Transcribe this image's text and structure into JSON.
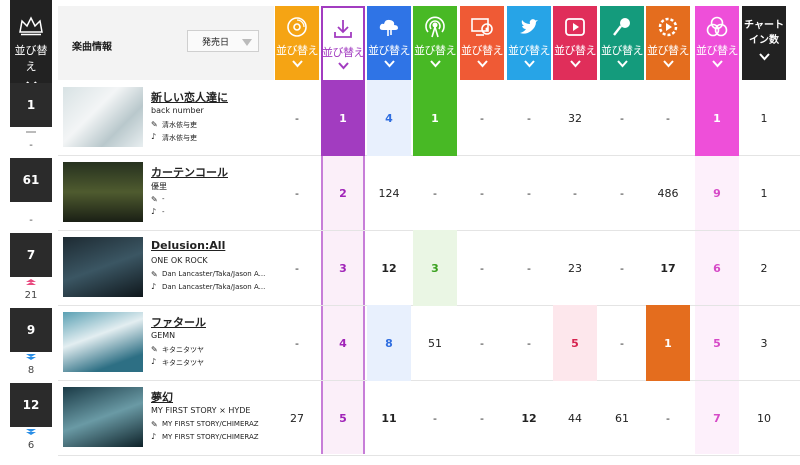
{
  "header": {
    "sort_label": "並び替え",
    "info_label": "楽曲情報",
    "release_select": "発売日",
    "chart_in_label_1": "チャート",
    "chart_in_label_2": "イン数"
  },
  "columns": [
    {
      "key": "cd",
      "color": "#f5a414",
      "icon": "cd-icon"
    },
    {
      "key": "download",
      "color": "#ffffff",
      "icon": "download-icon"
    },
    {
      "key": "streaming",
      "color": "#2f74e6",
      "icon": "cloud-music-icon"
    },
    {
      "key": "radio",
      "color": "#48b925",
      "icon": "broadcast-icon"
    },
    {
      "key": "karaoke_tv",
      "color": "#ef5a35",
      "icon": "tv-disc-icon"
    },
    {
      "key": "twitter",
      "color": "#27a4e7",
      "icon": "twitter-icon"
    },
    {
      "key": "youtube",
      "color": "#e02e5a",
      "icon": "play-icon"
    },
    {
      "key": "karaoke",
      "color": "#149b7c",
      "icon": "microphone-icon"
    },
    {
      "key": "gyao",
      "color": "#e46d1e",
      "icon": "video-gear-icon"
    },
    {
      "key": "total",
      "color": "#ee4fd9",
      "icon": "venn-icon"
    }
  ],
  "rows": [
    {
      "rank": "1",
      "prev": "-",
      "move": "same",
      "title": "新しい恋人達に",
      "artist": "back number",
      "lyricist": "清水依与吏",
      "composer": "清水依与吏",
      "values": [
        "-",
        "1",
        "4",
        "1",
        "-",
        "-",
        "32",
        "-",
        "-",
        "1"
      ],
      "chart_in": "1"
    },
    {
      "rank": "61",
      "prev": "-",
      "move": "none",
      "title": "カーテンコール",
      "artist": "優里",
      "lyricist": "-",
      "composer": "-",
      "values": [
        "-",
        "2",
        "124",
        "-",
        "-",
        "-",
        "-",
        "-",
        "486",
        "9"
      ],
      "chart_in": "1"
    },
    {
      "rank": "7",
      "prev": "21",
      "move": "up",
      "title": "Delusion:All",
      "artist": "ONE OK ROCK",
      "lyricist": "Dan Lancaster/Taka/Jason A...",
      "composer": "Dan Lancaster/Taka/Jason A...",
      "values": [
        "-",
        "3",
        "12",
        "3",
        "-",
        "-",
        "23",
        "-",
        "17",
        "6"
      ],
      "chart_in": "2"
    },
    {
      "rank": "9",
      "prev": "8",
      "move": "down",
      "title": "ファタール",
      "artist": "GEMN",
      "lyricist": "キタニタツヤ",
      "composer": "キタニタツヤ",
      "values": [
        "-",
        "4",
        "8",
        "51",
        "-",
        "-",
        "5",
        "-",
        "1",
        "5"
      ],
      "chart_in": "3"
    },
    {
      "rank": "12",
      "prev": "6",
      "move": "down",
      "title": "夢幻",
      "artist": "MY FIRST STORY × HYDE",
      "lyricist": "MY FIRST STORY/CHIMERAZ",
      "composer": "MY FIRST STORY/CHIMERAZ",
      "values": [
        "27",
        "5",
        "11",
        "-",
        "-",
        "12",
        "44",
        "61",
        "-",
        "7"
      ],
      "chart_in": "10"
    }
  ]
}
